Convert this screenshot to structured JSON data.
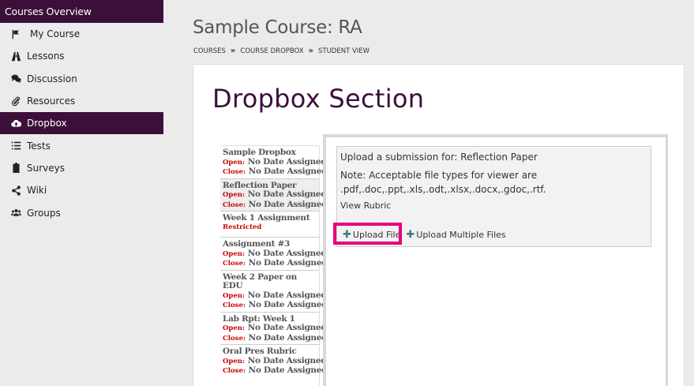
{
  "sidebar": {
    "header": "Courses Overview",
    "items": [
      {
        "label": "My Course",
        "icon": "flag-icon"
      },
      {
        "label": "Lessons",
        "icon": "road-icon"
      },
      {
        "label": "Discussion",
        "icon": "comments-icon"
      },
      {
        "label": "Resources",
        "icon": "paperclip-icon"
      },
      {
        "label": "Dropbox",
        "icon": "cloud-upload-icon",
        "active": true
      },
      {
        "label": "Tests",
        "icon": "list-icon"
      },
      {
        "label": "Surveys",
        "icon": "clipboard-icon"
      },
      {
        "label": "Wiki",
        "icon": "share-icon"
      },
      {
        "label": "Groups",
        "icon": "users-icon"
      }
    ]
  },
  "header": {
    "course_title": "Sample Course: RA",
    "breadcrumb": [
      "COURSES",
      "COURSE DROPBOX",
      "STUDENT VIEW"
    ],
    "separator": "»"
  },
  "main": {
    "section_title": "Dropbox Section",
    "assignments": [
      {
        "title": "Sample Dropbox",
        "open_label": "Open:",
        "open": "No Date Assigned",
        "close_label": "Close:",
        "close": "No Date Assigned"
      },
      {
        "title": "Reflection Paper",
        "open_label": "Open:",
        "open": "No Date Assigned",
        "close_label": "Close:",
        "close": "No Date Assigned",
        "selected": true
      },
      {
        "title": "Week 1 Assignment",
        "restricted": "Restricted"
      },
      {
        "title": "Assignment #3",
        "open_label": "Open:",
        "open": "No Date Assigned",
        "close_label": "Close:",
        "close": "No Date Assigned"
      },
      {
        "title": "Week 2 Paper on EDU",
        "open_label": "Open:",
        "open": "No Date Assigned",
        "close_label": "Close:",
        "close": "No Date Assigned"
      },
      {
        "title": "Lab Rpt: Week 1",
        "open_label": "Open:",
        "open": "No Date Assigned",
        "close_label": "Close:",
        "close": "No Date Assigned"
      },
      {
        "title": "Oral Pres Rubric",
        "open_label": "Open:",
        "open": "No Date Assigned",
        "close_label": "Close:",
        "close": "No Date Assigned"
      }
    ],
    "upload": {
      "heading": "Upload a submission for: Reflection Paper",
      "note": "Note: Acceptable file types for viewer are .pdf,.doc,.ppt,.xls,.odt,.xlsx,.docx,.gdoc,.rtf.",
      "rubric_link": "View Rubric",
      "upload_file": "Upload File",
      "upload_multiple": "Upload Multiple Files",
      "plus": "✚"
    }
  },
  "colors": {
    "brand": "#3c0f3b",
    "highlight": "#e6007e",
    "date_label": "#cc0000"
  }
}
